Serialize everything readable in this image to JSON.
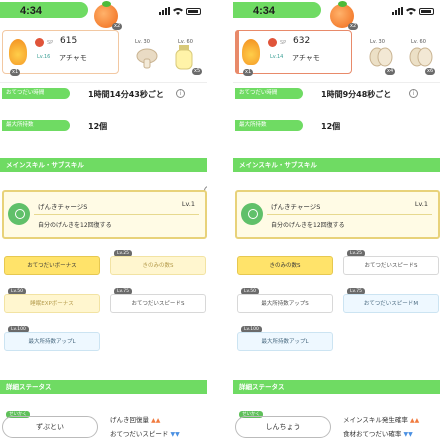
{
  "screens": [
    {
      "status_time": "4:34",
      "sp_label": "SP",
      "sp_value": "615",
      "pokemon_level": "Lv.16",
      "pokemon_name": "アチャモ",
      "ingredient_levels": [
        "Lv. 30",
        "Lv. 60"
      ],
      "help_time_label": "おてつだい時間",
      "help_time_value": "1時間14分43秒ごと",
      "max_carry_label": "最大所持数",
      "max_carry_value": "12個",
      "section_title": "メインスキル・サブスキル",
      "main_skill_name": "げんきチャージS",
      "main_skill_level": "Lv.1",
      "main_skill_desc": "自分のげんきを12回復する",
      "sub_skills": [
        {
          "label": "おてつだいボーナス",
          "lv": ""
        },
        {
          "label": "きのみの数S",
          "lv": "Lv.25"
        },
        {
          "label": "睡眠EXPボーナス",
          "lv": "Lv.50"
        },
        {
          "label": "おてつだいスピードS",
          "lv": "Lv.75"
        },
        {
          "label": "最大所持数アップL",
          "lv": "Lv.100"
        }
      ],
      "detail_title": "詳細ステータス",
      "nature_tag": "せいかく",
      "nature": "ずぶとい",
      "effects": [
        "げんき回復量",
        "おてつだいスピード"
      ]
    },
    {
      "status_time": "4:34",
      "sp_label": "SP",
      "sp_value": "632",
      "pokemon_level": "Lv.14",
      "pokemon_name": "アチャモ",
      "ingredient_levels": [
        "Lv. 30",
        "Lv. 60"
      ],
      "help_time_label": "おてつだい時間",
      "help_time_value": "1時間9分48秒ごと",
      "max_carry_label": "最大所持数",
      "max_carry_value": "12個",
      "section_title": "メインスキル・サブスキル",
      "main_skill_name": "げんきチャージS",
      "main_skill_level": "Lv.1",
      "main_skill_desc": "自分のげんきを12回復する",
      "sub_skills": [
        {
          "label": "きのみの数S",
          "lv": ""
        },
        {
          "label": "おてつだいスピードS",
          "lv": "Lv.25"
        },
        {
          "label": "最大所持数アップS",
          "lv": "Lv.50"
        },
        {
          "label": "おてつだいスピードM",
          "lv": "Lv.75"
        },
        {
          "label": "最大所持数アップL",
          "lv": "Lv.100"
        }
      ],
      "detail_title": "詳細ステータス",
      "nature_tag": "せいかく",
      "nature": "しんちょう",
      "effects": [
        "メインスキル発生確率",
        "食材おてつだい確率"
      ]
    }
  ]
}
